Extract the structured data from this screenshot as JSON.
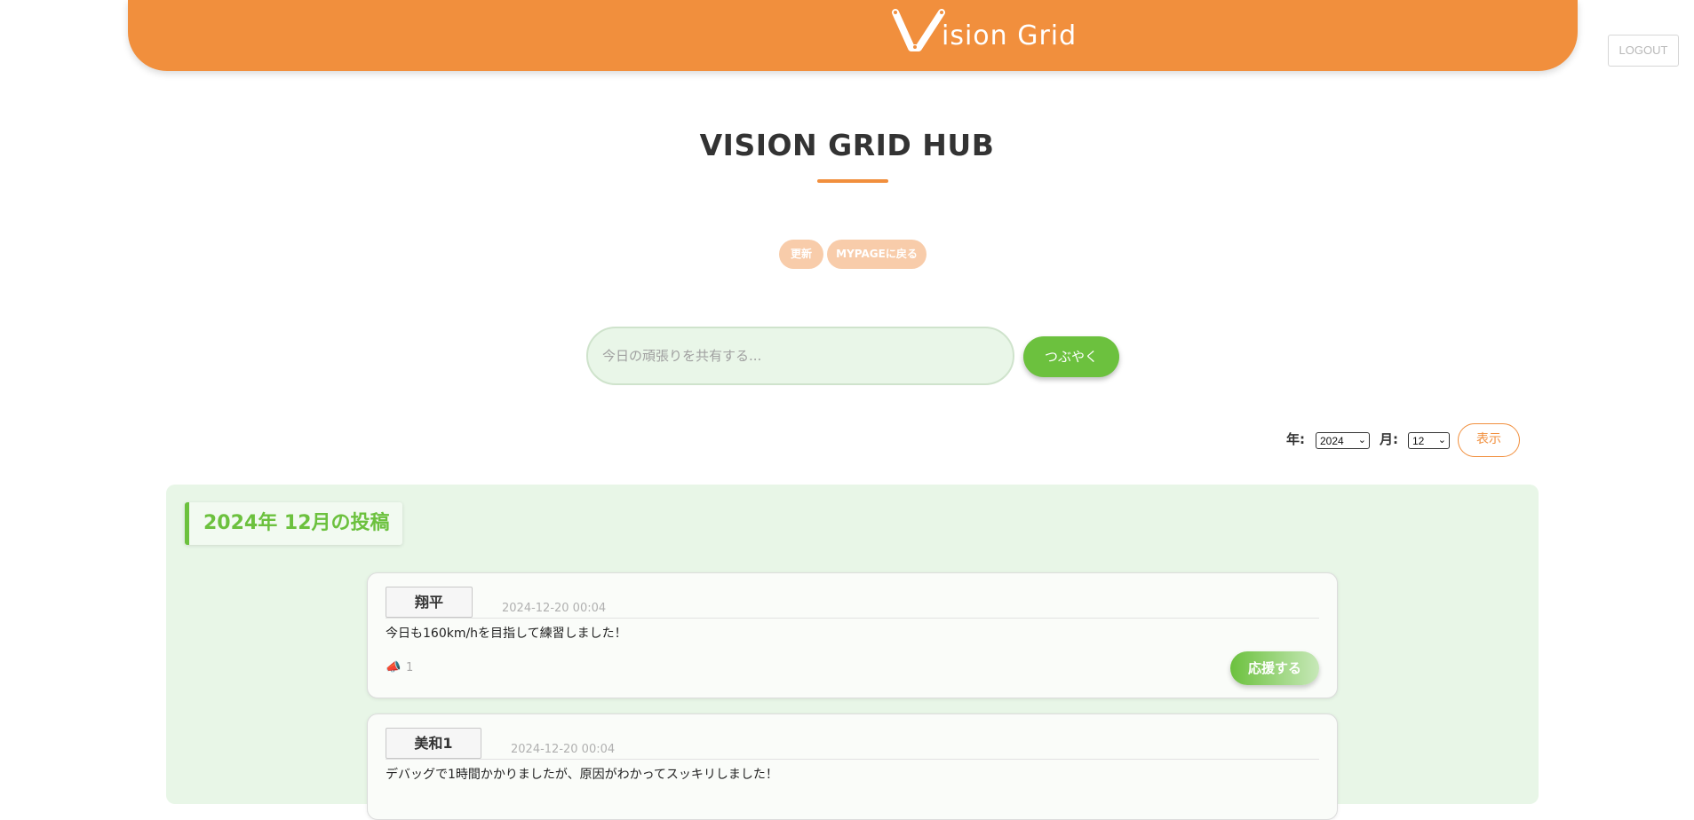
{
  "header": {
    "logo_text": "ision Grid",
    "logout_label": "LOGOUT",
    "brand_color": "#f18f3d"
  },
  "page": {
    "title": "VISION GRID HUB",
    "update_label": "更新",
    "mypage_label": "MYPAGEに戻る"
  },
  "composer": {
    "placeholder": "今日の頑張りを共有する...",
    "value": "",
    "submit_label": "つぶやく"
  },
  "filter": {
    "year_label": "年:",
    "year_value": "2024",
    "month_label": "月:",
    "month_value": "12",
    "show_label": "表示"
  },
  "feed": {
    "heading": "2024年 12月の投稿",
    "posts": [
      {
        "user": "翔平",
        "timestamp": "2024-12-20 00:04",
        "text": "今日も160km/hを目指して練習しました！",
        "cheer_count": "1",
        "cheer_label": "応援する"
      },
      {
        "user": "美和1",
        "timestamp": "2024-12-20 00:04",
        "text": "デバッグで1時間かかりましたが、原因がわかってスッキリしました！"
      }
    ]
  },
  "icons": {
    "logo": "v-mark-icon",
    "cheer": "megaphone-icon",
    "dropdown": "chevron-down-icon"
  }
}
